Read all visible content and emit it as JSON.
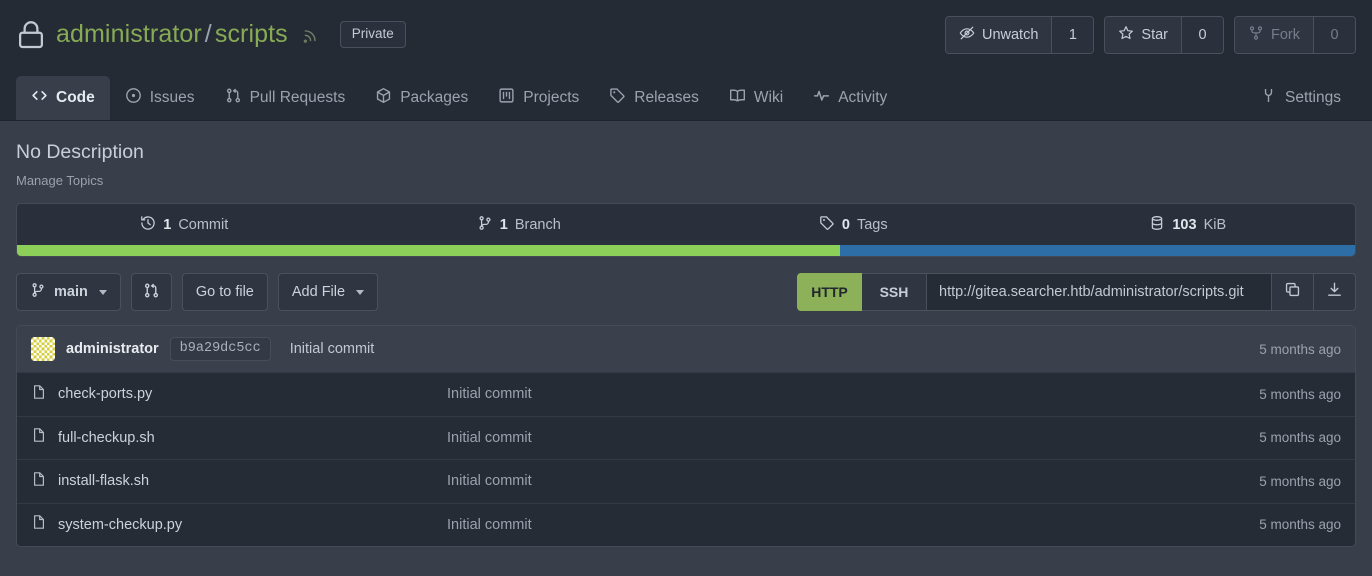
{
  "header": {
    "lock_icon": "lock-icon",
    "owner": "administrator",
    "separator": "/",
    "repo": "scripts",
    "rss_icon": "rss-icon",
    "private_badge": "Private",
    "actions": [
      {
        "icon": "eye-slash-icon",
        "label": "Unwatch",
        "count": "1",
        "disabled": false
      },
      {
        "icon": "star-icon",
        "label": "Star",
        "count": "0",
        "disabled": false
      },
      {
        "icon": "fork-icon",
        "label": "Fork",
        "count": "0",
        "disabled": true
      }
    ]
  },
  "tabs": [
    {
      "icon": "code-icon",
      "label": "Code",
      "active": true
    },
    {
      "icon": "issue-opened-icon",
      "label": "Issues",
      "active": false
    },
    {
      "icon": "git-pull-request-icon",
      "label": "Pull Requests",
      "active": false
    },
    {
      "icon": "package-icon",
      "label": "Packages",
      "active": false
    },
    {
      "icon": "project-icon",
      "label": "Projects",
      "active": false
    },
    {
      "icon": "tag-icon",
      "label": "Releases",
      "active": false
    },
    {
      "icon": "book-icon",
      "label": "Wiki",
      "active": false
    },
    {
      "icon": "pulse-icon",
      "label": "Activity",
      "active": false
    }
  ],
  "settings_tab": {
    "icon": "tools-icon",
    "label": "Settings"
  },
  "description": "No Description",
  "manage_topics": "Manage Topics",
  "stats": [
    {
      "icon": "history-icon",
      "value": "1",
      "label": "Commit"
    },
    {
      "icon": "git-branch-icon",
      "value": "1",
      "label": "Branch"
    },
    {
      "icon": "tag-icon",
      "value": "0",
      "label": "Tags"
    },
    {
      "icon": "database-icon",
      "value": "103",
      "label": "KiB"
    }
  ],
  "language_bar": [
    {
      "name": "green-language",
      "color": "#8cd05a",
      "percent": 61.5
    },
    {
      "name": "blue-language",
      "color": "#2e6ea6",
      "percent": 38.5
    }
  ],
  "toolbar": {
    "branch_icon": "git-branch-icon",
    "branch_name": "main",
    "pull_request_icon": "git-pull-request-icon",
    "go_to_file": "Go to file",
    "add_file": "Add File"
  },
  "clone": {
    "http_label": "HTTP",
    "ssh_label": "SSH",
    "url": "http://gitea.searcher.htb/administrator/scripts.git",
    "copy_icon": "copy-icon",
    "download_icon": "download-icon"
  },
  "latest_commit": {
    "avatar": "identicon-avatar",
    "author": "administrator",
    "sha": "b9a29dc5cc",
    "message": "Initial commit",
    "age": "5 months ago"
  },
  "files": [
    {
      "icon": "file-icon",
      "name": "check-ports.py",
      "message": "Initial commit",
      "age": "5 months ago"
    },
    {
      "icon": "file-icon",
      "name": "full-checkup.sh",
      "message": "Initial commit",
      "age": "5 months ago"
    },
    {
      "icon": "file-icon",
      "name": "install-flask.sh",
      "message": "Initial commit",
      "age": "5 months ago"
    },
    {
      "icon": "file-icon",
      "name": "system-checkup.py",
      "message": "Initial commit",
      "age": "5 months ago"
    }
  ]
}
